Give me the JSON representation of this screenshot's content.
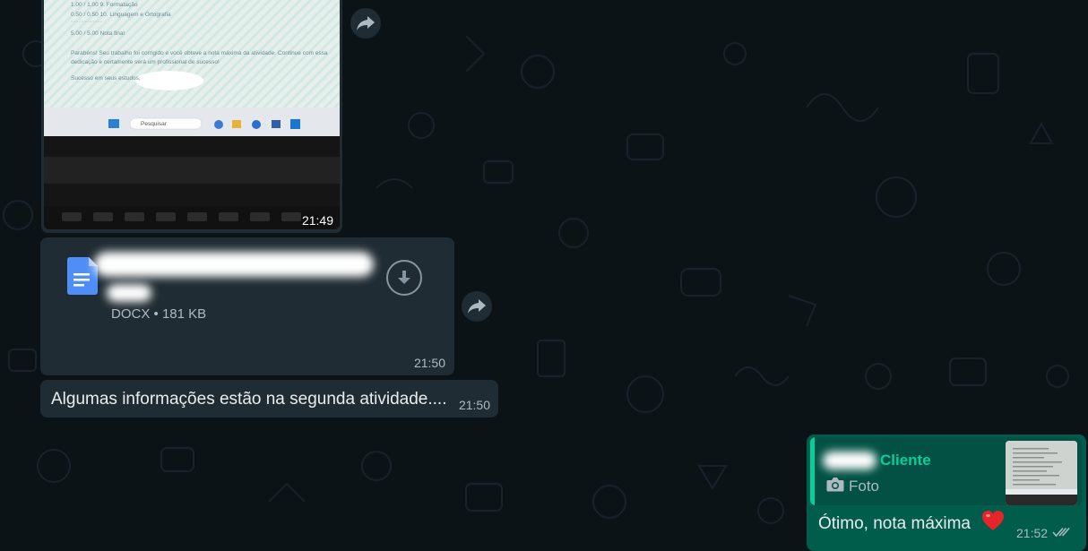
{
  "image_message": {
    "time": "21:49",
    "photo_lines": {
      "line1": "1.00 / 1.00      9. Formatação",
      "line2": "0.50 / 0.50      10. Linguagem e Ortografia",
      "line3": "5.00 / 5.00      Nota final",
      "line4": "Parabéns! Seu trabalho foi corrigido e você obteve a nota máxima da atividade. Continue com essa",
      "line5": "dedicação e certamente será um profissional de sucesso!",
      "line6": "Sucesso em seus estudos,",
      "taskbar_search": "Pesquisar"
    }
  },
  "document_message": {
    "type": "DOCX",
    "separator": "•",
    "size": "181 KB",
    "time": "21:50"
  },
  "text_message": {
    "text": "Algumas informações estão na segunda atividade....",
    "time": "21:50"
  },
  "outgoing_message": {
    "quote_name": "Cliente",
    "quote_type": "Foto",
    "text": "Ótimo, nota máxima",
    "time": "21:52"
  },
  "colors": {
    "background": "#0c1317",
    "incoming_bubble": "#202c33",
    "outgoing_bubble": "#005c4b",
    "accent": "#06cf9c",
    "doc_icon": "#4f8ef7",
    "heart": "#e5252a"
  },
  "icons": [
    "forward-icon",
    "document-icon",
    "download-icon",
    "camera-icon",
    "heart-emoji",
    "double-check-icon"
  ]
}
